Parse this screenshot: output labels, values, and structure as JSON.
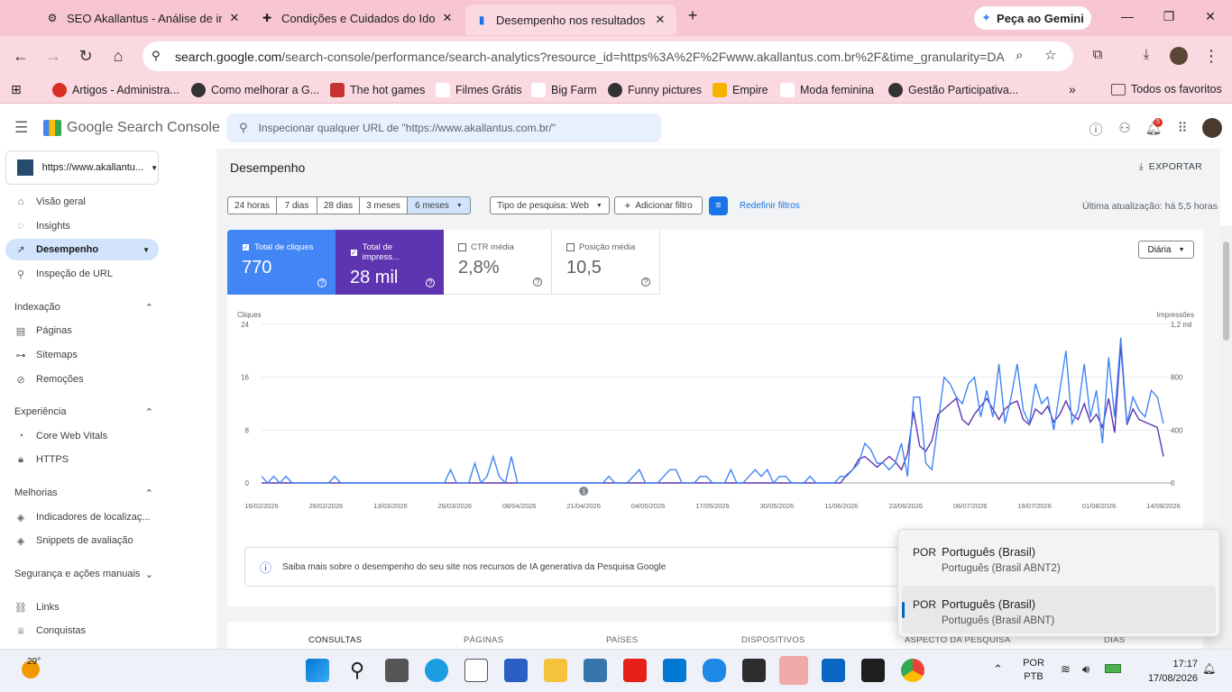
{
  "browser": {
    "tabs": [
      {
        "title": "SEO Akallantus - Análise de inde"
      },
      {
        "title": "Condições e Cuidados do Idoso"
      },
      {
        "title": "Desempenho nos resultados da"
      }
    ],
    "gemini_label": "Peça ao Gemini",
    "url_host": "search.google.com",
    "url_path": "/search-console/performance/search-analytics?resource_id=https%3A%2F%2Fwww.akallantus.com.br%2F&time_granularity=DA...",
    "bookmarks": [
      "Artigos - Administra...",
      "Como melhorar a G...",
      "The hot games",
      "Filmes Grátis",
      "Big Farm",
      "Funny pictures",
      "Empire",
      "Moda feminina",
      "Gestão Participativa..."
    ],
    "all_favorites": "Todos os favoritos",
    "notif_count": "5",
    "colors": {
      "tabbar": "#f7c6d0",
      "accent": "#1a73e8"
    }
  },
  "app": {
    "logo_text": "Google Search Console",
    "inspect_placeholder": "Inspecionar qualquer URL de \"https://www.akallantus.com.br/\"",
    "property": "https://www.akallantu..."
  },
  "sidebar": {
    "top": [
      "Visão geral",
      "Insights",
      "Desempenho",
      "Inspeção de URL"
    ],
    "sections": [
      {
        "title": "Indexação",
        "items": [
          "Páginas",
          "Sitemaps",
          "Remoções"
        ]
      },
      {
        "title": "Experiência",
        "items": [
          "Core Web Vitals",
          "HTTPS"
        ]
      },
      {
        "title": "Melhorias",
        "items": [
          "Indicadores de localizaç...",
          "Snippets de avaliação"
        ]
      },
      {
        "title": "Segurança e ações manuais",
        "items": []
      }
    ],
    "bottom": [
      "Links",
      "Conquistas"
    ]
  },
  "main": {
    "title": "Desempenho",
    "export": "EXPORTAR",
    "date_ranges": [
      "24 horas",
      "7 dias",
      "28 dias",
      "3 meses",
      "6 meses"
    ],
    "search_type": "Tipo de pesquisa: Web",
    "add_filter": "Adicionar filtro",
    "reset": "Redefinir filtros",
    "updated": "Última atualização: há 5,5 horas",
    "granularity": "Diária",
    "metrics": [
      {
        "label": "Total de cliques",
        "value": "770",
        "checked": true,
        "color": "#4285f4"
      },
      {
        "label": "Total de impress...",
        "value": "28 mil",
        "checked": true,
        "color": "#5e35b1"
      },
      {
        "label": "CTR média",
        "value": "2,8%",
        "checked": false
      },
      {
        "label": "Posição média",
        "value": "10,5",
        "checked": false
      }
    ],
    "ai_info": "Saiba mais sobre o desempenho do seu site nos recursos de IA generativa da Pesquisa Google",
    "bottom_tabs": [
      "CONSULTAS",
      "PÁGINAS",
      "PAÍSES",
      "DISPOSITIVOS",
      "ASPECTO DA PESQUISA",
      "DIAS"
    ]
  },
  "chart_data": {
    "type": "line",
    "left_axis_label": "Cliques",
    "right_axis_label": "Impressões",
    "left_ticks": [
      "24",
      "16",
      "8",
      "0"
    ],
    "right_ticks": [
      "1,2 mil",
      "800",
      "400",
      "0"
    ],
    "x_ticks": [
      "16/02/2026",
      "28/02/2026",
      "13/03/2026",
      "26/03/2026",
      "08/04/2026",
      "21/04/2026",
      "04/05/2026",
      "17/05/2026",
      "30/05/2026",
      "11/06/2026",
      "23/06/2026",
      "06/07/2026",
      "19/07/2026",
      "01/08/2026",
      "14/08/2026"
    ],
    "ylim_left": [
      0,
      24
    ],
    "ylim_right": [
      0,
      1200
    ],
    "annotation": "1",
    "series": [
      {
        "name": "Total de cliques",
        "color": "#4285f4",
        "values": [
          1,
          0,
          1,
          0,
          1,
          0,
          0,
          0,
          0,
          0,
          0,
          0,
          1,
          0,
          0,
          0,
          0,
          0,
          0,
          0,
          0,
          0,
          0,
          0,
          0,
          0,
          0,
          0,
          0,
          0,
          0,
          2,
          0,
          0,
          0,
          3,
          0,
          1,
          4,
          1,
          0,
          4,
          0,
          0,
          0,
          0,
          0,
          0,
          0,
          0,
          0,
          0,
          0,
          0,
          0,
          0,
          0,
          1,
          0,
          0,
          0,
          1,
          2,
          0,
          0,
          0,
          1,
          2,
          2,
          0,
          0,
          0,
          1,
          1,
          0,
          0,
          0,
          2,
          0,
          0,
          1,
          2,
          1,
          2,
          0,
          1,
          1,
          0,
          0,
          0,
          1,
          0,
          0,
          0,
          0,
          1,
          1,
          2,
          3,
          6,
          5,
          3,
          3,
          2,
          3,
          6,
          1,
          13,
          13,
          3,
          2,
          9,
          16,
          15,
          13,
          12,
          15,
          16,
          10,
          14,
          10,
          18,
          9,
          13,
          18,
          11,
          9,
          15,
          12,
          13,
          8,
          14,
          20,
          9,
          11,
          18,
          10,
          14,
          6,
          19,
          10,
          22,
          9,
          13,
          11,
          10,
          14,
          13,
          9
        ]
      },
      {
        "name": "Total de impressões",
        "values": [
          0,
          0,
          0,
          0,
          0,
          0,
          0,
          0,
          0,
          0,
          0,
          0,
          0,
          0,
          0,
          0,
          0,
          0,
          0,
          0,
          0,
          0,
          0,
          0,
          0,
          0,
          0,
          0,
          0,
          0,
          0,
          0,
          0,
          0,
          0,
          0,
          0,
          0,
          0,
          0,
          0,
          0,
          0,
          0,
          0,
          0,
          0,
          0,
          0,
          0,
          0,
          0,
          0,
          0,
          0,
          0,
          0,
          0,
          0,
          0,
          0,
          0,
          0,
          0,
          0,
          0,
          0,
          0,
          0,
          0,
          0,
          0,
          0,
          0,
          0,
          0,
          0,
          0,
          0,
          0,
          0,
          0,
          0,
          0,
          0,
          0,
          0,
          0,
          0,
          0,
          0,
          0,
          0,
          0,
          0,
          0,
          60,
          100,
          180,
          200,
          160,
          120,
          160,
          200,
          160,
          100,
          220,
          540,
          280,
          240,
          320,
          520,
          560,
          600,
          640,
          480,
          440,
          520,
          580,
          640,
          560,
          480,
          560,
          600,
          620,
          480,
          440,
          560,
          520,
          580,
          460,
          520,
          620,
          520,
          480,
          600,
          460,
          520,
          420,
          640,
          380,
          1040,
          440,
          560,
          480,
          460,
          440,
          420,
          200
        ]
      }
    ]
  },
  "language_popup": [
    {
      "code": "POR",
      "name": "Português (Brasil)",
      "layout": "Português (Brasil ABNT2)"
    },
    {
      "code": "POR",
      "name": "Português (Brasil)",
      "layout": "Português (Brasil ABNT)"
    }
  ],
  "taskbar": {
    "weather": "29°",
    "lang1": "POR",
    "lang2": "PTB",
    "time": "17:17",
    "date": "17/08/2026"
  }
}
